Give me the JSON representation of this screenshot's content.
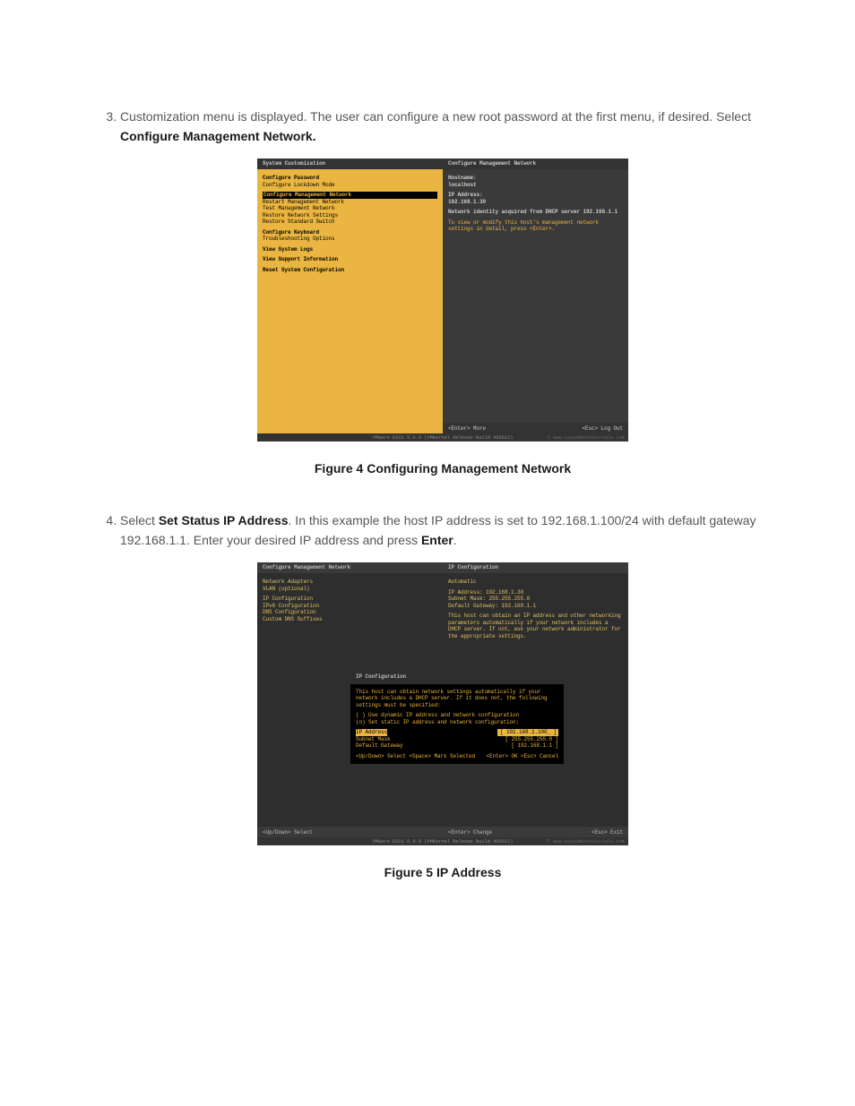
{
  "list": {
    "item3": {
      "text_a": "Customization menu is displayed. The user can configure a new root password at the first menu, if desired. Select ",
      "bold": "Configure Management Network."
    },
    "item4": {
      "text_a": "Select ",
      "bold_a": "Set Status IP Address",
      "text_b": ". In this example the host IP address is set to 192.168.1.100/24 with default gateway 192.168.1.1. Enter your desired IP address and press ",
      "bold_b": "Enter",
      "text_c": "."
    }
  },
  "fig4": {
    "caption": "Figure 4 Configuring Management Network",
    "left_title": "System Customization",
    "right_title": "Configure Management Network",
    "menu": [
      "Configure Password",
      "Configure Lockdown Mode"
    ],
    "menu_selected": "Configure Management Network",
    "menu2": [
      "Restart Management Network",
      "Test Management Network",
      "Restore Network Settings",
      "Restore Standard Switch"
    ],
    "menu3": [
      "Configure Keyboard",
      "Troubleshooting Options"
    ],
    "menu4": "View System Logs",
    "menu5": "View Support Information",
    "menu6": "Reset System Configuration",
    "right": {
      "host_lbl": "Hostname:",
      "host_val": "localhost",
      "ip_lbl": "IP Address:",
      "ip_val": "192.168.1.30",
      "identity": "Network identity acquired from DHCP server 192.168.1.1",
      "help": "To view or modify this host's management network settings in detail, press <Enter>.",
      "foot_l": "<Enter> More",
      "foot_r": "<Esc> Log Out"
    },
    "status": "VMware ESXi 5.0.0 (VMKernel Release Build 469512)"
  },
  "fig5": {
    "caption": "Figure 5 IP Address",
    "left_title": "Configure Management Network",
    "right_title": "IP Configuration",
    "menu1": [
      "Network Adapters",
      "VLAN (optional)"
    ],
    "menu2": [
      "IP Configuration",
      "IPv6 Configuration",
      "DNS Configuration",
      "Custom DNS Suffixes"
    ],
    "right": {
      "mode": "Automatic",
      "ip": "IP Address: 192.168.1.30",
      "mask": "Subnet Mask: 255.255.255.0",
      "gw": "Default Gateway: 192.168.1.1",
      "help": "This host can obtain an IP address and other networking parameters automatically if your network includes a DHCP server. If not, ask your network administrator for the appropriate settings."
    },
    "dialog": {
      "title": "IP Configuration",
      "intro": "This host can obtain network settings automatically if your network includes a DHCP server. If it does not, the following settings must be specified:",
      "opt_a": "( ) Use dynamic IP address and network configuration",
      "opt_b": "(o) Set static IP address and network configuration:",
      "rows": [
        {
          "l": "IP Address",
          "r": "192.168.1.100_",
          "sel": true
        },
        {
          "l": "Subnet Mask",
          "r": "255.255.255.0"
        },
        {
          "l": "Default Gateway",
          "r": "192.168.1.1"
        }
      ],
      "foot_l": "<Up/Down> Select  <Space> Mark Selected",
      "foot_r": "<Enter> OK  <Esc> Cancel"
    },
    "footer": {
      "l": "<Up/Down> Select",
      "c": "<Enter> Change",
      "r": "<Esc> Exit"
    },
    "status": "VMware ESXi 5.0.0 (VMKernel Release Build 469512)"
  }
}
